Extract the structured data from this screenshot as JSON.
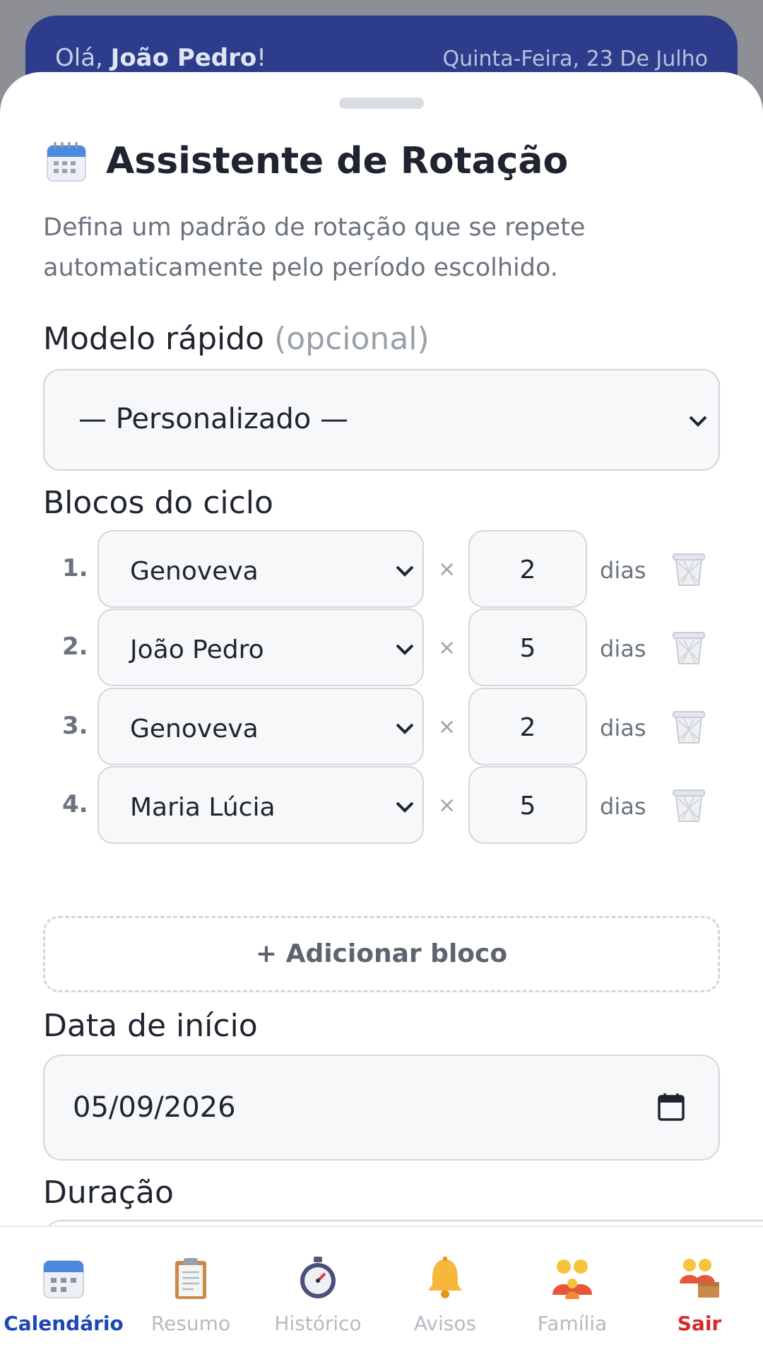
{
  "header": {
    "greeting_prefix": "Olá, ",
    "user_name": "João Pedro",
    "greeting_suffix": "!",
    "date": "Quinta-Feira, 23 De Julho"
  },
  "sheet": {
    "title": "Assistente de Rotação",
    "title_icon": "calendar-icon",
    "description": "Defina um padrão de rotação que se repete automaticamente pelo período escolhido.",
    "template_label": "Modelo rápido",
    "template_optional": "(opcional)",
    "template_value": "— Personalizado —",
    "blocks_label": "Blocos do ciclo",
    "blocks": [
      {
        "number": "1.",
        "person": "Genoveva",
        "times": "×",
        "days": "2",
        "unit": "dias"
      },
      {
        "number": "2.",
        "person": "João Pedro",
        "times": "×",
        "days": "5",
        "unit": "dias"
      },
      {
        "number": "3.",
        "person": "Genoveva",
        "times": "×",
        "days": "2",
        "unit": "dias"
      },
      {
        "number": "4.",
        "person": "Maria Lúcia",
        "times": "×",
        "days": "5",
        "unit": "dias"
      }
    ],
    "add_block_label": "+ Adicionar bloco",
    "start_date_label": "Data de início",
    "start_date_value": "05/09/2026",
    "duration_label": "Duração"
  },
  "nav": {
    "items": [
      {
        "label": "Calendário",
        "icon": "calendar-icon",
        "active": true
      },
      {
        "label": "Resumo",
        "icon": "clipboard-icon"
      },
      {
        "label": "Histórico",
        "icon": "stopwatch-icon"
      },
      {
        "label": "Avisos",
        "icon": "bell-icon"
      },
      {
        "label": "Família",
        "icon": "family-icon"
      },
      {
        "label": "Sair",
        "icon": "logout-people-icon"
      }
    ]
  },
  "colors": {
    "header_bg": "#1c2f8a",
    "active_nav": "#1d47b8",
    "logout": "#d52b2b"
  }
}
